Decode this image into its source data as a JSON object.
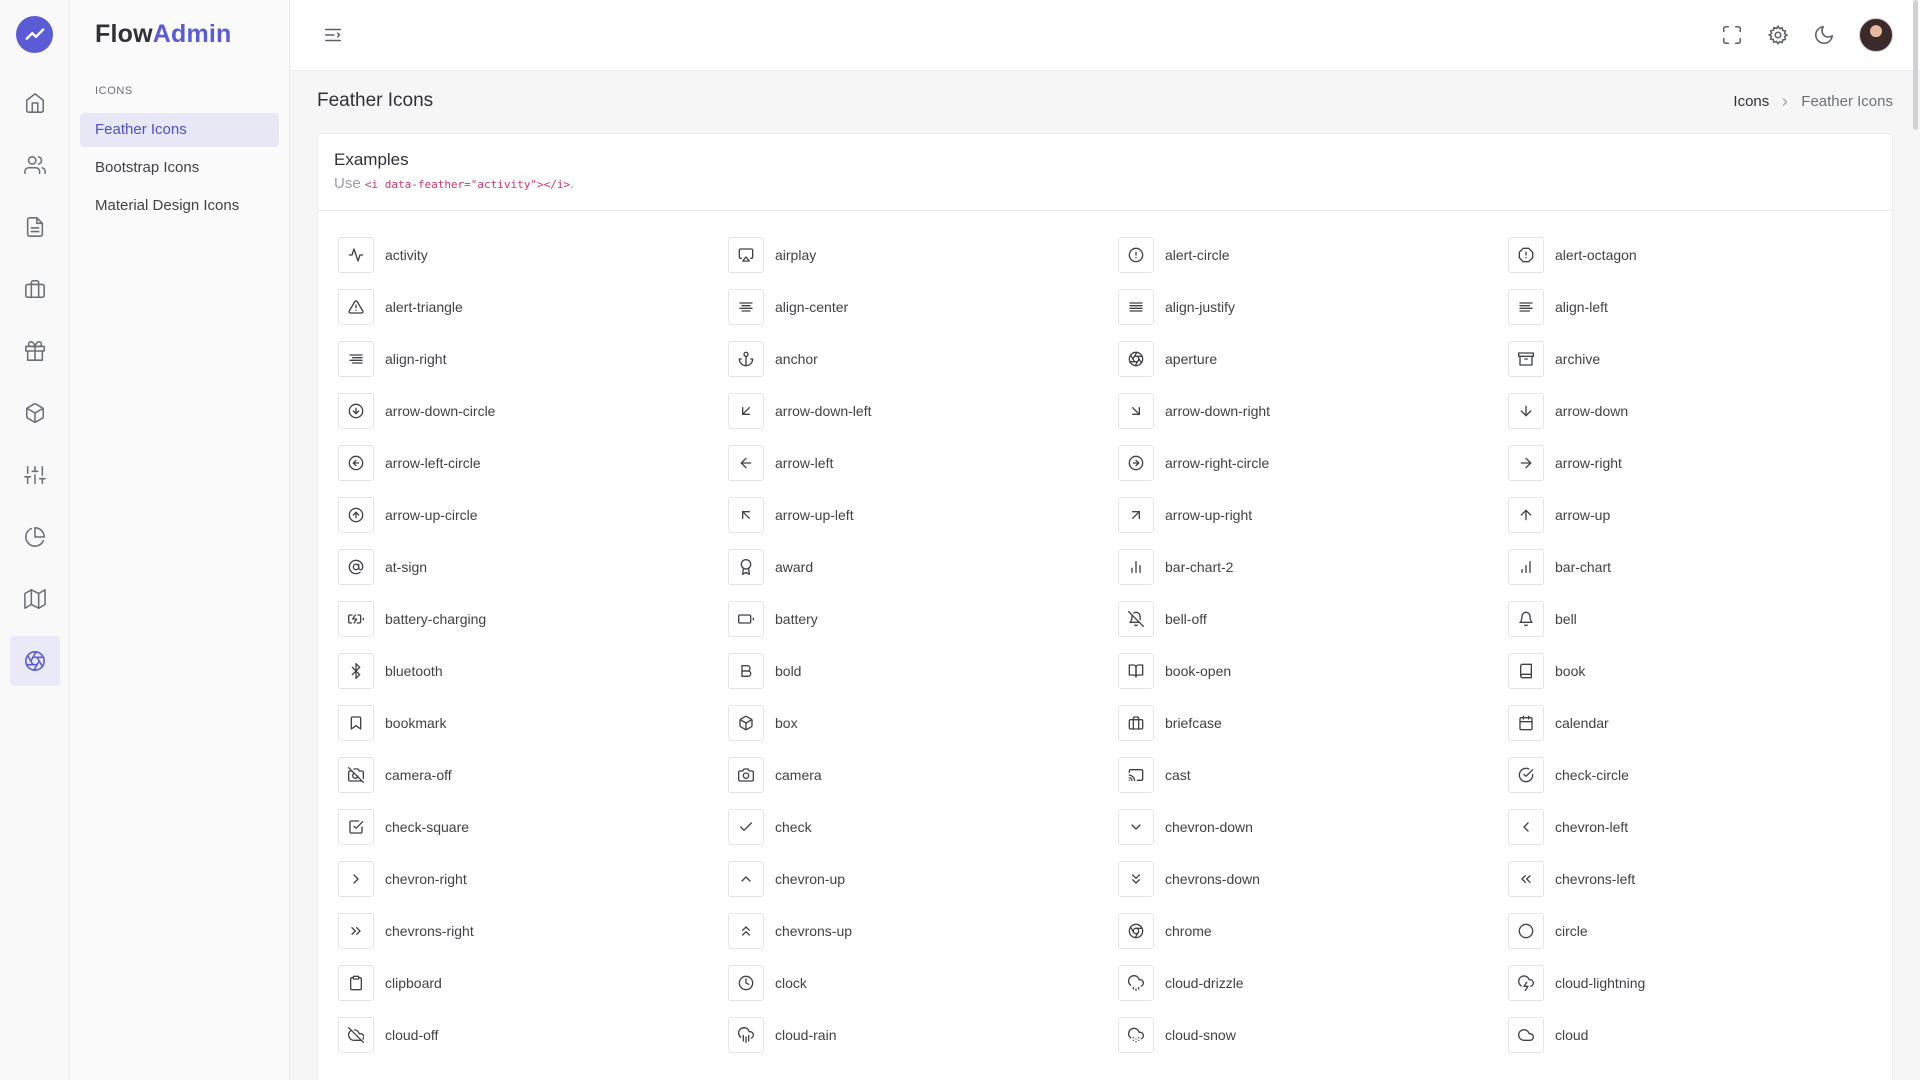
{
  "app": {
    "brand_part1": "Flow",
    "brand_part2": "Admin"
  },
  "rail": {
    "items": [
      {
        "name": "home-icon",
        "active": false
      },
      {
        "name": "users-icon",
        "active": false
      },
      {
        "name": "file-text-icon",
        "active": false
      },
      {
        "name": "briefcase-icon",
        "active": false
      },
      {
        "name": "gift-icon",
        "active": false
      },
      {
        "name": "box-icon",
        "active": false
      },
      {
        "name": "sliders-icon",
        "active": false
      },
      {
        "name": "pie-chart-icon",
        "active": false
      },
      {
        "name": "map-icon",
        "active": false
      },
      {
        "name": "aperture-icon",
        "active": true
      }
    ]
  },
  "sidebar": {
    "section_label": "ICONS",
    "items": [
      {
        "label": "Feather Icons",
        "active": true
      },
      {
        "label": "Bootstrap Icons",
        "active": false
      },
      {
        "label": "Material Design Icons",
        "active": false
      }
    ]
  },
  "topbar": {
    "icons": [
      "menu-icon",
      "maximize-icon",
      "settings-icon",
      "moon-icon",
      "avatar"
    ]
  },
  "page": {
    "title": "Feather Icons",
    "breadcrumb": [
      "Icons",
      "Feather Icons"
    ]
  },
  "card": {
    "title": "Examples",
    "subtitle_prefix": "Use ",
    "subtitle_code": "<i data-feather=\"activity\"></i>",
    "subtitle_suffix": "."
  },
  "icons": [
    "activity",
    "airplay",
    "alert-circle",
    "alert-octagon",
    "alert-triangle",
    "align-center",
    "align-justify",
    "align-left",
    "align-right",
    "anchor",
    "aperture",
    "archive",
    "arrow-down-circle",
    "arrow-down-left",
    "arrow-down-right",
    "arrow-down",
    "arrow-left-circle",
    "arrow-left",
    "arrow-right-circle",
    "arrow-right",
    "arrow-up-circle",
    "arrow-up-left",
    "arrow-up-right",
    "arrow-up",
    "at-sign",
    "award",
    "bar-chart-2",
    "bar-chart",
    "battery-charging",
    "battery",
    "bell-off",
    "bell",
    "bluetooth",
    "bold",
    "book-open",
    "book",
    "bookmark",
    "box",
    "briefcase",
    "calendar",
    "camera-off",
    "camera",
    "cast",
    "check-circle",
    "check-square",
    "check",
    "chevron-down",
    "chevron-left",
    "chevron-right",
    "chevron-up",
    "chevrons-down",
    "chevrons-left",
    "chevrons-right",
    "chevrons-up",
    "chrome",
    "circle",
    "clipboard",
    "clock",
    "cloud-drizzle",
    "cloud-lightning",
    "cloud-off",
    "cloud-rain",
    "cloud-snow",
    "cloud"
  ],
  "colors": {
    "accent": "#5b5bd6",
    "code": "#d6336c"
  }
}
